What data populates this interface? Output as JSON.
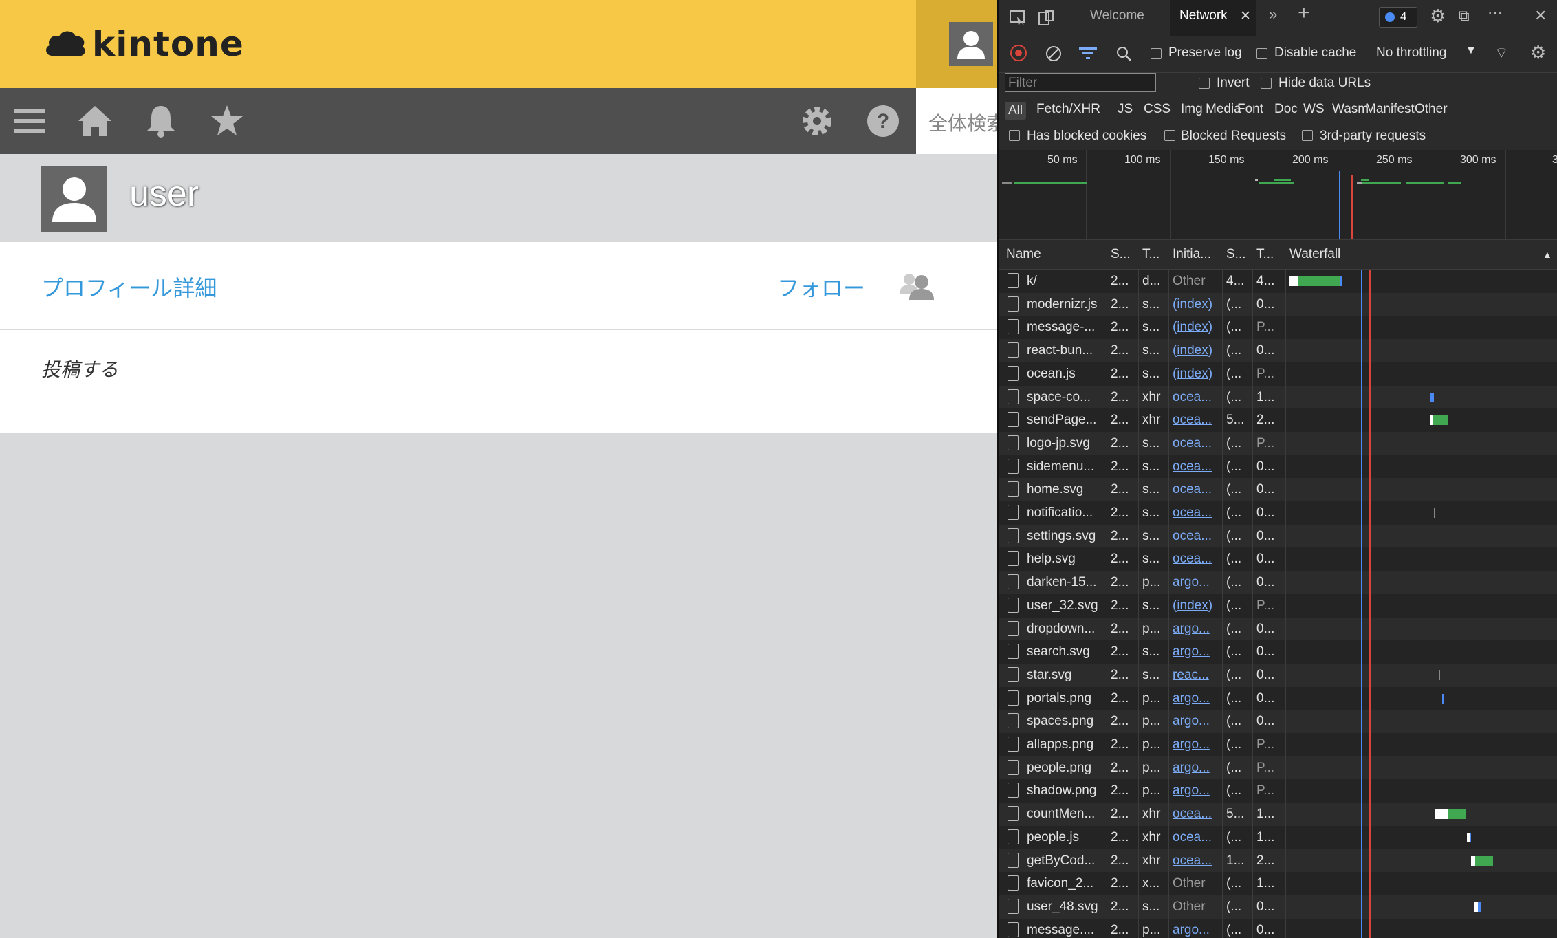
{
  "kintone": {
    "logo_text": "kintone",
    "search_placeholder": "全体検索",
    "username": "user",
    "profile_link": "プロフィール詳細",
    "follow_label": "フォロー",
    "post_label": "投稿する",
    "nav_icons": [
      "menu-icon",
      "home-icon",
      "bell-icon",
      "star-icon",
      "gear-icon",
      "help-icon"
    ]
  },
  "devtools": {
    "tabs": {
      "welcome": "Welcome",
      "network": "Network",
      "messages_count": "4"
    },
    "toolbar": {
      "preserve_log": "Preserve log",
      "disable_cache": "Disable cache",
      "throttling": "No throttling"
    },
    "filter": {
      "placeholder": "Filter",
      "invert": "Invert",
      "hide_data_urls": "Hide data URLs",
      "types": [
        "All",
        "Fetch/XHR",
        "JS",
        "CSS",
        "Img",
        "Media",
        "Font",
        "Doc",
        "WS",
        "Wasm",
        "Manifest",
        "Other"
      ],
      "has_blocked_cookies": "Has blocked cookies",
      "blocked_requests": "Blocked Requests",
      "third_party": "3rd-party requests"
    },
    "overview_ticks": [
      "50 ms",
      "100 ms",
      "150 ms",
      "200 ms",
      "250 ms",
      "300 ms",
      "3"
    ],
    "columns": {
      "name": "Name",
      "status": "S...",
      "type": "T...",
      "initiator": "Initia...",
      "size": "S...",
      "time": "T...",
      "waterfall": "Waterfall"
    },
    "rows": [
      {
        "name": "k/",
        "status": "2...",
        "type": "d...",
        "initiator": "Other",
        "size": "4...",
        "time": "4..."
      },
      {
        "name": "modernizr.js",
        "status": "2...",
        "type": "s...",
        "initiator": "(index)",
        "size": "(...",
        "time": "0..."
      },
      {
        "name": "message-...",
        "status": "2...",
        "type": "s...",
        "initiator": "(index)",
        "size": "(...",
        "time": "P..."
      },
      {
        "name": "react-bun...",
        "status": "2...",
        "type": "s...",
        "initiator": "(index)",
        "size": "(...",
        "time": "0..."
      },
      {
        "name": "ocean.js",
        "status": "2...",
        "type": "s...",
        "initiator": "(index)",
        "size": "(...",
        "time": "P..."
      },
      {
        "name": "space-co...",
        "status": "2...",
        "type": "xhr",
        "initiator": "ocea...",
        "size": "(...",
        "time": "1..."
      },
      {
        "name": "sendPage...",
        "status": "2...",
        "type": "xhr",
        "initiator": "ocea...",
        "size": "5...",
        "time": "2..."
      },
      {
        "name": "logo-jp.svg",
        "status": "2...",
        "type": "s...",
        "initiator": "ocea...",
        "size": "(...",
        "time": "P..."
      },
      {
        "name": "sidemenu...",
        "status": "2...",
        "type": "s...",
        "initiator": "ocea...",
        "size": "(...",
        "time": "0..."
      },
      {
        "name": "home.svg",
        "status": "2...",
        "type": "s...",
        "initiator": "ocea...",
        "size": "(...",
        "time": "0..."
      },
      {
        "name": "notificatio...",
        "status": "2...",
        "type": "s...",
        "initiator": "ocea...",
        "size": "(...",
        "time": "0..."
      },
      {
        "name": "settings.svg",
        "status": "2...",
        "type": "s...",
        "initiator": "ocea...",
        "size": "(...",
        "time": "0..."
      },
      {
        "name": "help.svg",
        "status": "2...",
        "type": "s...",
        "initiator": "ocea...",
        "size": "(...",
        "time": "0..."
      },
      {
        "name": "darken-15...",
        "status": "2...",
        "type": "p...",
        "initiator": "argo...",
        "size": "(...",
        "time": "0..."
      },
      {
        "name": "user_32.svg",
        "status": "2...",
        "type": "s...",
        "initiator": "(index)",
        "size": "(...",
        "time": "P..."
      },
      {
        "name": "dropdown...",
        "status": "2...",
        "type": "p...",
        "initiator": "argo...",
        "size": "(...",
        "time": "0..."
      },
      {
        "name": "search.svg",
        "status": "2...",
        "type": "s...",
        "initiator": "argo...",
        "size": "(...",
        "time": "0..."
      },
      {
        "name": "star.svg",
        "status": "2...",
        "type": "s...",
        "initiator": "reac...",
        "size": "(...",
        "time": "0..."
      },
      {
        "name": "portals.png",
        "status": "2...",
        "type": "p...",
        "initiator": "argo...",
        "size": "(...",
        "time": "0..."
      },
      {
        "name": "spaces.png",
        "status": "2...",
        "type": "p...",
        "initiator": "argo...",
        "size": "(...",
        "time": "0..."
      },
      {
        "name": "allapps.png",
        "status": "2...",
        "type": "p...",
        "initiator": "argo...",
        "size": "(...",
        "time": "P..."
      },
      {
        "name": "people.png",
        "status": "2...",
        "type": "p...",
        "initiator": "argo...",
        "size": "(...",
        "time": "P..."
      },
      {
        "name": "shadow.png",
        "status": "2...",
        "type": "p...",
        "initiator": "argo...",
        "size": "(...",
        "time": "P..."
      },
      {
        "name": "countMen...",
        "status": "2...",
        "type": "xhr",
        "initiator": "ocea...",
        "size": "5...",
        "time": "1..."
      },
      {
        "name": "people.js",
        "status": "2...",
        "type": "xhr",
        "initiator": "ocea...",
        "size": "(...",
        "time": "1..."
      },
      {
        "name": "getByCod...",
        "status": "2...",
        "type": "xhr",
        "initiator": "ocea...",
        "size": "1...",
        "time": "2..."
      },
      {
        "name": "favicon_2...",
        "status": "2...",
        "type": "x...",
        "initiator": "Other",
        "size": "(...",
        "time": "1..."
      },
      {
        "name": "user_48.svg",
        "status": "2...",
        "type": "s...",
        "initiator": "Other",
        "size": "(...",
        "time": "0..."
      },
      {
        "name": "message....",
        "status": "2...",
        "type": "p...",
        "initiator": "argo...",
        "size": "(...",
        "time": "0..."
      }
    ],
    "colors": {
      "accent": "#7cacf8",
      "bar_green": "#41a852",
      "bar_blue": "#4a8af4",
      "red_line": "#d9453a"
    }
  }
}
